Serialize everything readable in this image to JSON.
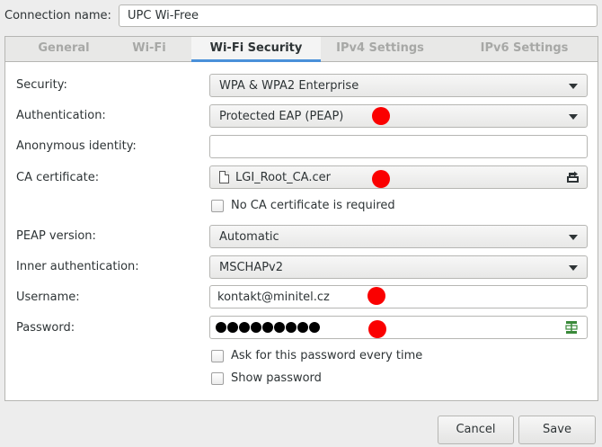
{
  "connection": {
    "label": "Connection name:",
    "value": "UPC Wi-Free"
  },
  "tabs": [
    {
      "label": "General",
      "active": false
    },
    {
      "label": "Wi-Fi",
      "active": false
    },
    {
      "label": "Wi-Fi Security",
      "active": true
    },
    {
      "label": "IPv4 Settings",
      "active": false
    },
    {
      "label": "IPv6 Settings",
      "active": false
    }
  ],
  "security": {
    "label": "Security:",
    "value": "WPA & WPA2 Enterprise"
  },
  "authentication": {
    "label": "Authentication:",
    "value": "Protected EAP (PEAP)"
  },
  "anonymous_identity": {
    "label": "Anonymous identity:",
    "value": ""
  },
  "ca_certificate": {
    "label": "CA certificate:",
    "value": "LGI_Root_CA.cer",
    "icon": "document-icon"
  },
  "no_ca_required": {
    "label": "No CA certificate is required",
    "checked": false
  },
  "peap_version": {
    "label": "PEAP version:",
    "value": "Automatic"
  },
  "inner_authentication": {
    "label": "Inner authentication:",
    "value": "MSCHAPv2"
  },
  "username": {
    "label": "Username:",
    "value": "kontakt@minitel.cz"
  },
  "password": {
    "label": "Password:",
    "masked_length": 9,
    "icon": "password-storage-icon"
  },
  "ask_password": {
    "label": "Ask for this password every time",
    "checked": false
  },
  "show_password": {
    "label": "Show password",
    "checked": false
  },
  "buttons": {
    "cancel": "Cancel",
    "save": "Save"
  },
  "colors": {
    "accent": "#4a90d9",
    "marker": "#fa0000"
  }
}
